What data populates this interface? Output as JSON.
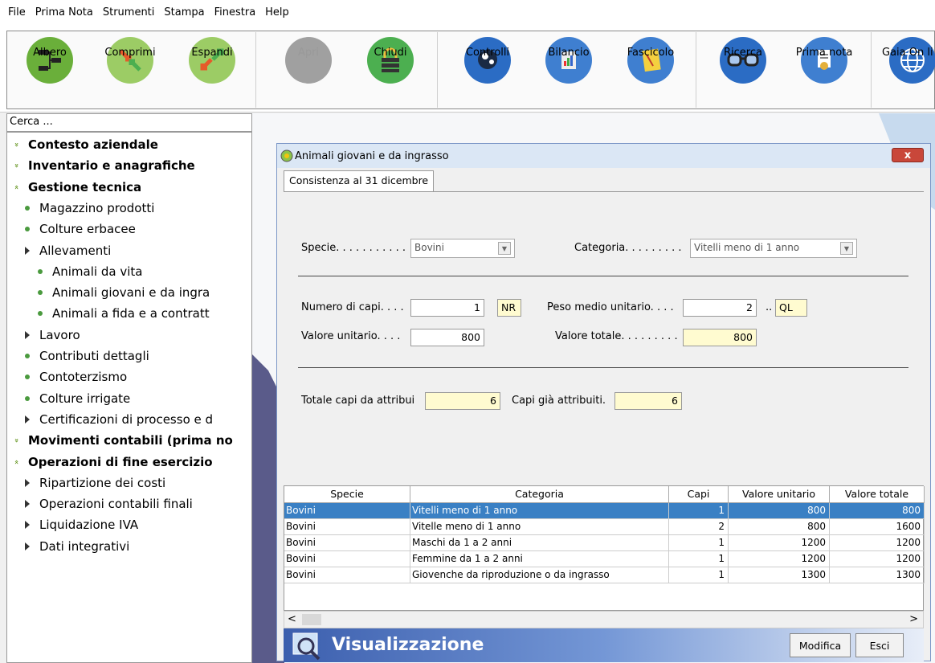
{
  "menu": [
    "File",
    "Prima Nota",
    "Strumenti",
    "Stampa",
    "Finestra",
    "Help"
  ],
  "toolbar": {
    "buttons": [
      {
        "label": "Albero",
        "icon": "tree-icon",
        "color": "#6aaf3a"
      },
      {
        "label": "Comprimi",
        "icon": "compress-icon",
        "color": "#8bc34a"
      },
      {
        "label": "Espandi",
        "icon": "expand-icon",
        "color": "#8bc34a"
      },
      {
        "label": "Apri",
        "icon": "open-icon",
        "color": "#9e9e9e"
      },
      {
        "label": "Chiudi",
        "icon": "close-lock-icon",
        "color": "#4caf50"
      },
      {
        "label": "Controlli",
        "icon": "controls-icon",
        "color": "#2b6cc4"
      },
      {
        "label": "Bilancio",
        "icon": "balance-icon",
        "color": "#2b6cc4"
      },
      {
        "label": "Fascicolo",
        "icon": "folder-icon",
        "color": "#3f7fd0"
      },
      {
        "label": "Ricerca",
        "icon": "glasses-icon",
        "color": "#2b6cc4"
      },
      {
        "label": "Prima nota",
        "icon": "certificate-icon",
        "color": "#3f7fd0"
      },
      {
        "label": "Gaia On li",
        "icon": "globe-icon",
        "color": "#2b6cc4"
      }
    ]
  },
  "search": {
    "placeholder": "Cerca ..."
  },
  "tree": [
    {
      "label": "Contesto aziendale",
      "level": 0,
      "type": "collapsed-group"
    },
    {
      "label": "Inventario e anagrafiche",
      "level": 0,
      "type": "collapsed-group"
    },
    {
      "label": "Gestione tecnica",
      "level": 0,
      "type": "expanded-group"
    },
    {
      "label": "Magazzino prodotti",
      "level": 1,
      "type": "leaf"
    },
    {
      "label": "Colture erbacee",
      "level": 1,
      "type": "leaf"
    },
    {
      "label": "Allevamenti",
      "level": 1,
      "type": "branch"
    },
    {
      "label": "Animali da vita",
      "level": 2,
      "type": "leaf"
    },
    {
      "label": "Animali giovani e da ingra",
      "level": 2,
      "type": "leaf"
    },
    {
      "label": "Animali a fida e a contratt",
      "level": 2,
      "type": "leaf"
    },
    {
      "label": "Lavoro",
      "level": 1,
      "type": "branch"
    },
    {
      "label": "Contributi dettagli",
      "level": 1,
      "type": "leaf"
    },
    {
      "label": "Contoterzismo",
      "level": 1,
      "type": "leaf"
    },
    {
      "label": "Colture irrigate",
      "level": 1,
      "type": "leaf"
    },
    {
      "label": "Certificazioni di processo e d",
      "level": 1,
      "type": "branch"
    },
    {
      "label": "Movimenti contabili (prima no",
      "level": 0,
      "type": "collapsed-group"
    },
    {
      "label": "Operazioni di fine esercizio",
      "level": 0,
      "type": "expanded-group"
    },
    {
      "label": "Ripartizione dei costi",
      "level": 1,
      "type": "branch"
    },
    {
      "label": "Operazioni contabili finali",
      "level": 1,
      "type": "branch"
    },
    {
      "label": "Liquidazione IVA",
      "level": 1,
      "type": "branch"
    },
    {
      "label": "Dati integrativi",
      "level": 1,
      "type": "branch"
    }
  ],
  "window": {
    "title": "Animali giovani e da ingrasso",
    "close": "x",
    "tab": "Consistenza al 31 dicembre",
    "specie_label": "Specie. . . . . . . . . . .",
    "specie_value": "Bovini",
    "categoria_label": "Categoria. . . . . . . . .",
    "categoria_value": "Vitelli meno di 1 anno",
    "numero_label": "Numero di capi. . . .",
    "numero_value": "1",
    "numero_unit": "NR",
    "peso_label": "Peso medio unitario. . . .",
    "peso_value": "2",
    "peso_sep": "..",
    "peso_unit": "QL",
    "valore_unit_label": "Valore unitario. . . .",
    "valore_unit_value": "800",
    "valore_tot_label": "Valore totale. . . . . . . . .",
    "valore_tot_value": "800",
    "totale_label": "Totale capi da attribui",
    "totale_value": "6",
    "gia_label": "Capi già attribuiti.",
    "gia_value": "6",
    "columns": [
      "Specie",
      "Categoria",
      "Capi",
      "Valore unitario",
      "Valore totale"
    ],
    "rows": [
      [
        "Bovini",
        "Vitelli meno di 1 anno",
        "1",
        "800",
        "800"
      ],
      [
        "Bovini",
        "Vitelle meno di 1 anno",
        "2",
        "800",
        "1600"
      ],
      [
        "Bovini",
        "Maschi da 1 a 2 anni",
        "1",
        "1200",
        "1200"
      ],
      [
        "Bovini",
        "Femmine da 1 a 2 anni",
        "1",
        "1200",
        "1200"
      ],
      [
        "Bovini",
        "Giovenche da riproduzione o da ingrasso",
        "1",
        "1300",
        "1300"
      ]
    ],
    "scroll_left": "<",
    "scroll_right": ">",
    "footer_title": "Visualizzazione",
    "modifica": "Modifica",
    "esci": "Esci"
  }
}
